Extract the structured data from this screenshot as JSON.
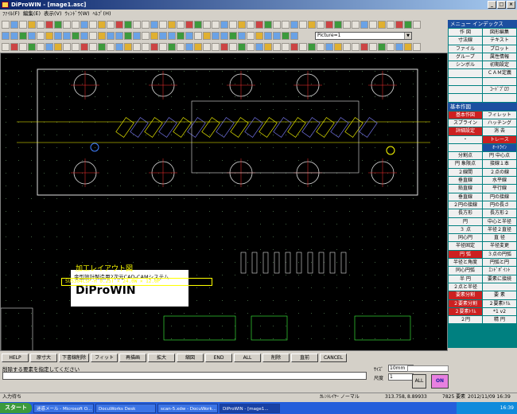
{
  "window": {
    "title": "DiProWIN - [mage1.asc]"
  },
  "menu": [
    "ﾌｧｲﾙ(F)",
    "編集(E)",
    "表示(V)",
    "ｳｨﾝﾄﾞｳ(W)",
    "ﾍﾙﾌﾟ(H)"
  ],
  "picture_select": "Picture=1",
  "panel": {
    "header1": "メニュー インデックス",
    "menu_buttons": [
      {
        "label": "作 図",
        "style": "normal"
      },
      {
        "label": "図形編集",
        "style": "normal"
      },
      {
        "label": "寸法線",
        "style": "normal"
      },
      {
        "label": "テキスト",
        "style": "normal"
      },
      {
        "label": "ファイル",
        "style": "normal"
      },
      {
        "label": "プロット",
        "style": "normal"
      },
      {
        "label": "グループ",
        "style": "normal"
      },
      {
        "label": "属性情報",
        "style": "normal"
      },
      {
        "label": "シンボル",
        "style": "normal"
      },
      {
        "label": "初期設定",
        "style": "normal"
      },
      {
        "label": "",
        "style": "empty"
      },
      {
        "label": "ＣＡＭ定義",
        "style": "normal"
      },
      {
        "label": "",
        "style": "empty"
      },
      {
        "label": "",
        "style": "empty"
      },
      {
        "label": "",
        "style": "empty"
      },
      {
        "label": "ｺｰﾄﾞﾌﾟﾛﾜ",
        "style": "normal"
      },
      {
        "label": "",
        "style": "empty"
      },
      {
        "label": "",
        "style": "empty"
      }
    ],
    "header2": "基本作図",
    "draw_buttons": [
      {
        "label": "基本作図",
        "style": "red"
      },
      {
        "label": "フィレット",
        "style": "normal"
      },
      {
        "label": "スプライン",
        "style": "normal"
      },
      {
        "label": "ハッチング",
        "style": "normal"
      },
      {
        "label": "詳細設定",
        "style": "red"
      },
      {
        "label": "消 去",
        "style": "normal"
      },
      {
        "label": "・",
        "style": "normal"
      },
      {
        "label": "トレース",
        "style": "red"
      },
      {
        "label": "",
        "style": "normal"
      },
      {
        "label": "ｵｰﾄﾗｲﾝ",
        "style": "blue"
      },
      {
        "label": "分割点",
        "style": "normal"
      },
      {
        "label": "円 中心点",
        "style": "normal"
      },
      {
        "label": "円 象限点",
        "style": "normal"
      },
      {
        "label": "接線１本",
        "style": "normal"
      },
      {
        "label": "２線間",
        "style": "normal"
      },
      {
        "label": "２点の線",
        "style": "normal"
      },
      {
        "label": "垂直線",
        "style": "normal"
      },
      {
        "label": "水平線",
        "style": "normal"
      },
      {
        "label": "鉛直線",
        "style": "normal"
      },
      {
        "label": "平行線",
        "style": "normal"
      },
      {
        "label": "垂直線",
        "style": "normal"
      },
      {
        "label": "円の接線",
        "style": "normal"
      },
      {
        "label": "２円の接線",
        "style": "normal"
      },
      {
        "label": "円の長さ",
        "style": "normal"
      },
      {
        "label": "長方形",
        "style": "normal"
      },
      {
        "label": "長方形２",
        "style": "normal"
      },
      {
        "label": "円",
        "style": "normal"
      },
      {
        "label": "中心と半径",
        "style": "normal"
      },
      {
        "label": "３ 点",
        "style": "normal"
      },
      {
        "label": "半径２直径",
        "style": "normal"
      },
      {
        "label": "同心円",
        "style": "normal"
      },
      {
        "label": "直 径",
        "style": "normal"
      },
      {
        "label": "半径固定",
        "style": "normal"
      },
      {
        "label": "半径変更",
        "style": "normal"
      },
      {
        "label": "円 弧",
        "style": "red"
      },
      {
        "label": "３点の円弧",
        "style": "normal"
      },
      {
        "label": "半径と角度",
        "style": "normal"
      },
      {
        "label": "円弧と円",
        "style": "normal"
      },
      {
        "label": "同心円弧",
        "style": "normal"
      },
      {
        "label": "ｴﾝﾄﾞﾎﾟｲﾝﾄ",
        "style": "normal"
      },
      {
        "label": "半 円",
        "style": "normal"
      },
      {
        "label": "要素に接続",
        "style": "normal"
      },
      {
        "label": "２点と半径",
        "style": "normal"
      },
      {
        "label": "",
        "style": "normal"
      },
      {
        "label": "要素分割",
        "style": "red"
      },
      {
        "label": "要 素",
        "style": "normal"
      },
      {
        "label": "２要素分割",
        "style": "red"
      },
      {
        "label": "２要素ﾄﾘﾑ",
        "style": "normal"
      },
      {
        "label": "２要素ﾄﾘﾑ",
        "style": "red"
      },
      {
        "label": "*1 v2",
        "style": "normal"
      },
      {
        "label": "２円",
        "style": "normal"
      },
      {
        "label": "精 円",
        "style": "normal"
      }
    ]
  },
  "canvas": {
    "info_subtitle": "金型設計製造用2次元CAD-CAMシステム",
    "info_title": "DiProWIN",
    "layout_title": "加工レイアウト図",
    "spec": "SUS304CSP-H  0.25T × 24.0W × 12.0P"
  },
  "function_keys": [
    "HELP",
    "原寸大",
    "下書線削除",
    "フィット",
    "再描画",
    "拡大",
    "縮図",
    "END",
    "ALL",
    "削除",
    "直前",
    "CANCEL"
  ],
  "prompt": "削除する要素を指定してください",
  "side_controls": {
    "label1": "ｻｲｽﾞ",
    "value1": "10mm",
    "label2": "尺度",
    "value2": "1",
    "all_label": "ALL",
    "on_label": "ON"
  },
  "status": {
    "left": "入力待ち",
    "layer": "ｶﾚﾝﾄﾚｲﾔｰ ノーマル",
    "x": "313.758,",
    "y": "8.89933",
    "info": "7825 要素",
    "datetime": "2012/11/09 16:39"
  },
  "taskbar": {
    "start": "スタート",
    "tasks": [
      "迷惑メール - Microsoft O...",
      "DocuWorks Desk",
      "scan-5.xdw - DocuWork...",
      "DiProWIN - [mage1..."
    ],
    "clock": "16:39"
  }
}
